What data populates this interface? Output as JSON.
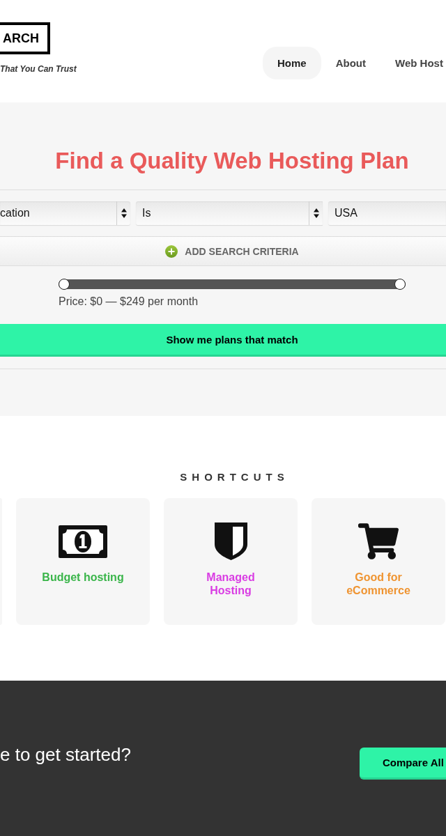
{
  "logo": {
    "text": "ARCH",
    "tagline": "That You Can Trust"
  },
  "nav": [
    {
      "label": "Home",
      "selected": true
    },
    {
      "label": "About",
      "selected": false
    },
    {
      "label": "Web Host",
      "selected": false
    }
  ],
  "search": {
    "title": "Find a Quality Web Hosting Plan",
    "criteria": [
      {
        "kind": "select",
        "value": "cation"
      },
      {
        "kind": "select",
        "value": "Is"
      },
      {
        "kind": "text",
        "value": "USA"
      }
    ],
    "add_criteria": "ADD SEARCH CRITERIA",
    "price_slider": {
      "level": 1,
      "reading": "Price: $0 — $249 per month"
    },
    "submit": "Show me plans that match"
  },
  "shortcuts": {
    "heading": "SHORTCUTS",
    "items": [
      {
        "kind": "money",
        "label": "Budget hosting",
        "color": "#3ab54a"
      },
      {
        "kind": "shield",
        "label": "Managed Hosting",
        "color": "#d93ce3"
      },
      {
        "kind": "cart",
        "label": "Good for eCommerce",
        "color": "#ef9431"
      }
    ]
  },
  "cta": {
    "text": "e to get started?",
    "button": "Compare All"
  }
}
